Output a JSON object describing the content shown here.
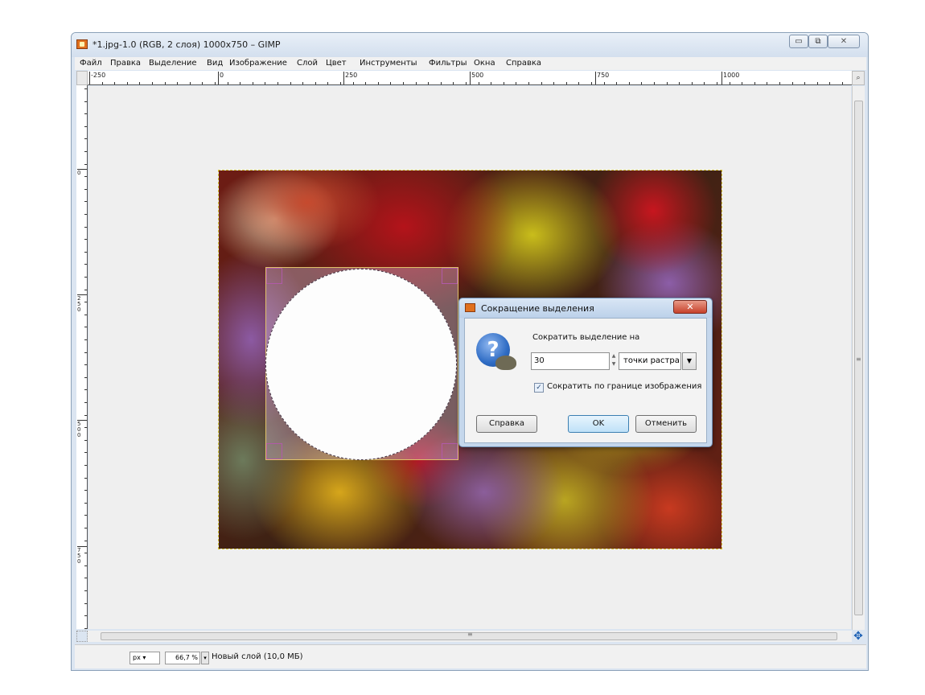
{
  "window": {
    "title": "*1.jpg-1.0 (RGB, 2 слоя) 1000x750 – GIMP",
    "controls": {
      "minimize": "▭",
      "maximize": "⧉",
      "close": "✕"
    }
  },
  "menu": [
    "Файл",
    "Правка",
    "Выделение",
    "Вид",
    "Изображение",
    "Слой",
    "Цвет",
    "Инструменты",
    "Фильтры",
    "Окна",
    "Справка"
  ],
  "ruler_top_labels": [
    "-250",
    "0",
    "250",
    "500",
    "750",
    "1000"
  ],
  "ruler_left_labels": [
    "0",
    "250",
    "500",
    "750"
  ],
  "scroll_grip": "≡",
  "nav_icon": "move-arrows",
  "status": {
    "unit": "px",
    "zoom": "66,7 %",
    "layer_info": "Новый слой (10,0 МБ)"
  },
  "dialog": {
    "title": "Сокращение выделения",
    "prompt": "Сократить выделение на",
    "amount": "30",
    "unit": "точки растра",
    "checkbox_checked": true,
    "checkbox_label": "Сократить по границе изображения",
    "buttons": {
      "help": "Справка",
      "ok": "OK",
      "cancel": "Отменить"
    },
    "icon": "question-icon"
  }
}
